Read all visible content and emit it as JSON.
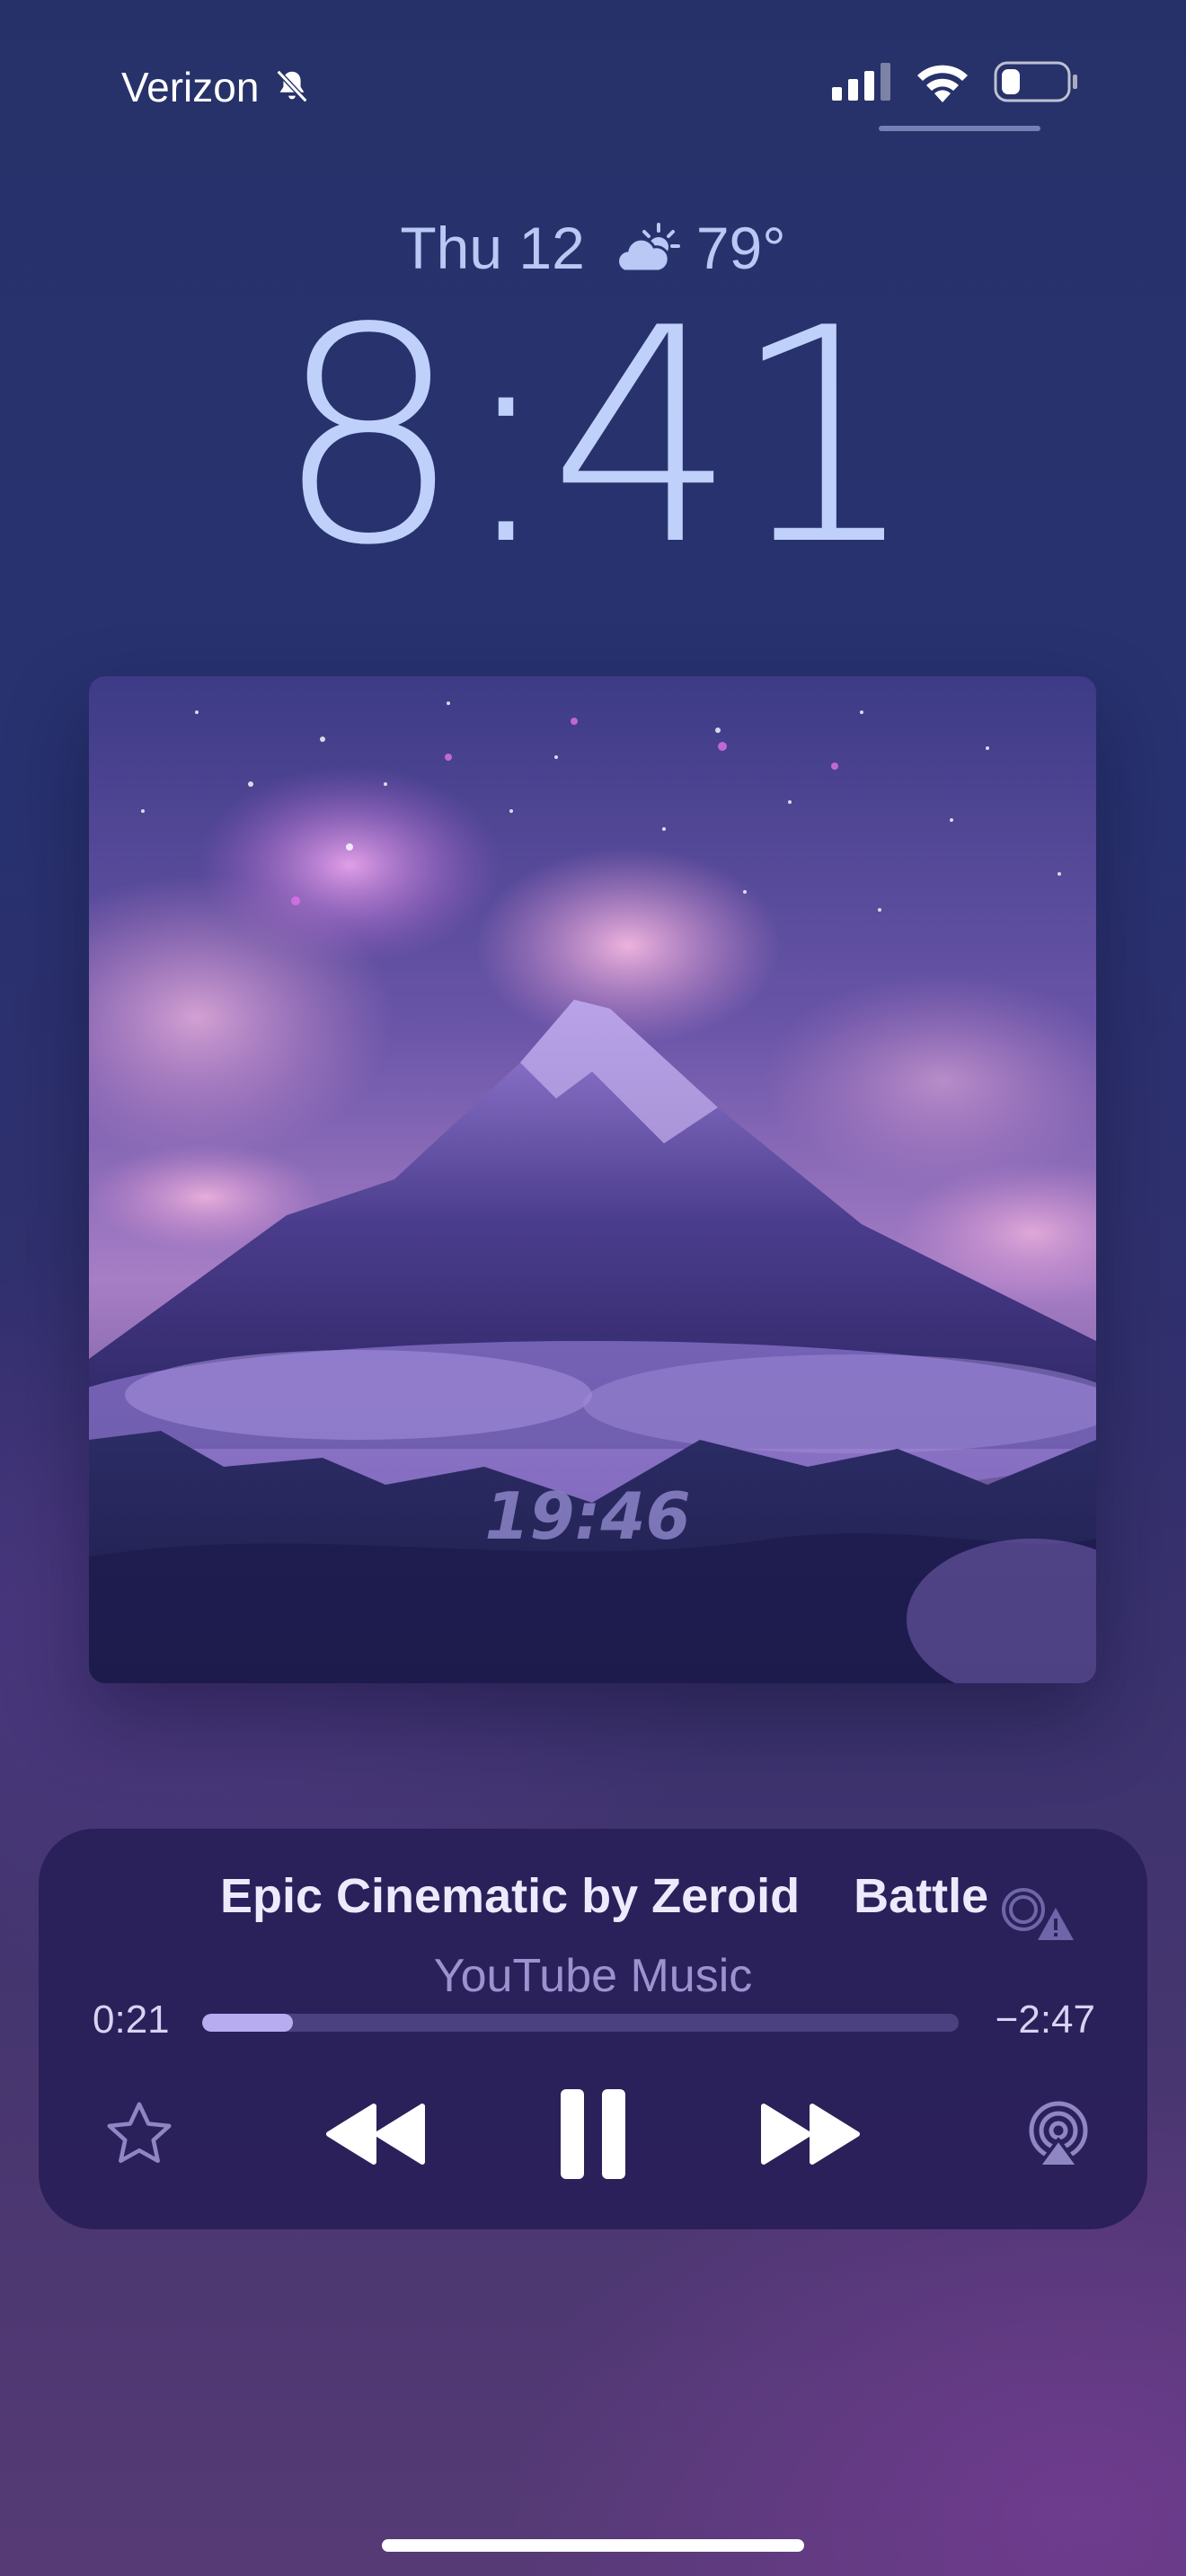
{
  "status_bar": {
    "carrier": "Verizon",
    "silent_icon": "bell-slash-icon",
    "battery_level": 0.25
  },
  "lock_screen": {
    "date": "Thu 12",
    "weather_icon": "partly-sunny-icon",
    "temperature": "79°",
    "time": "8:41"
  },
  "artwork": {
    "overlay_text": "19:46"
  },
  "now_playing": {
    "title_scroll": [
      "Epic Cinematic by Zeroid",
      "Battle"
    ],
    "source": "YouTube Music",
    "elapsed": "0:21",
    "remaining": "−2:47",
    "progress": 0.12,
    "controls": {
      "favorite": "star-icon",
      "previous": "backward-icon",
      "pause": "pause-icon",
      "next": "forward-icon",
      "airplay": "airplay-audio-icon"
    }
  },
  "colors": {
    "accent": "#b6acef",
    "clock": "#bfd0fa",
    "player_bg": "#2a2259"
  }
}
